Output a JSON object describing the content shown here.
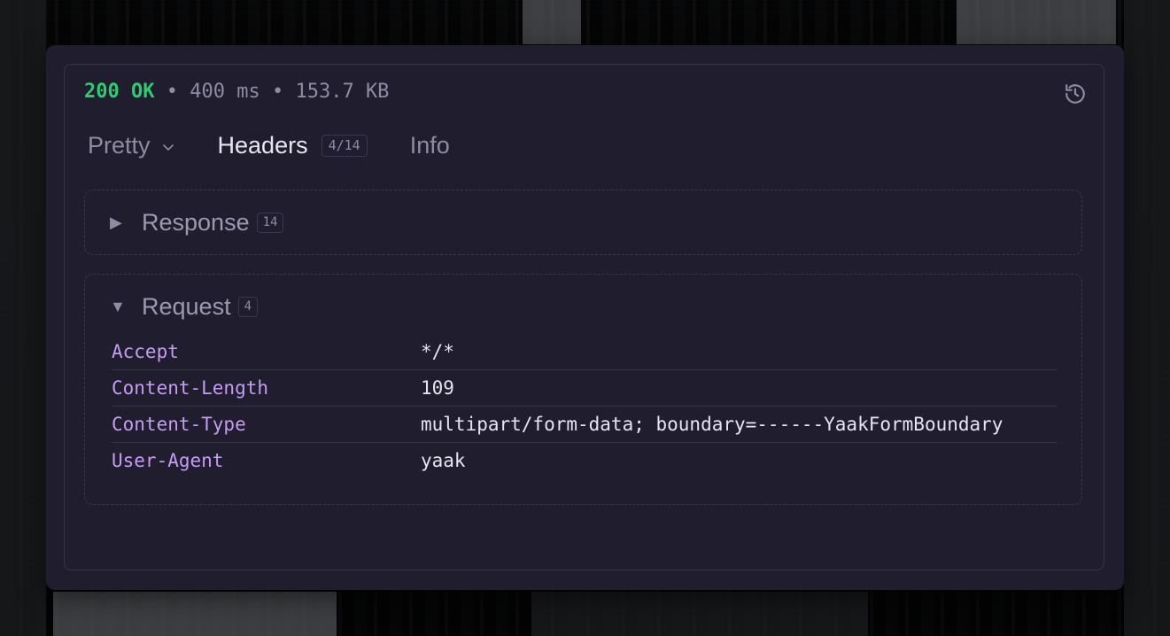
{
  "status": {
    "code": "200 OK",
    "time": "400 ms",
    "size": "153.7 KB",
    "separator": "•"
  },
  "history_icon": "history-icon",
  "tabs": [
    {
      "label": "Pretty",
      "icon": "chevron-down-icon"
    },
    {
      "label": "Headers",
      "badge": "4/14"
    },
    {
      "label": "Info"
    }
  ],
  "response_section": {
    "label": "Response",
    "count": "14",
    "expanded": false
  },
  "request_section": {
    "label": "Request",
    "count": "4",
    "expanded": true,
    "headers": [
      {
        "name": "Accept",
        "value": "*/*"
      },
      {
        "name": "Content-Length",
        "value": "109"
      },
      {
        "name": "Content-Type",
        "value": "multipart/form-data; boundary=------YaakFormBoundary"
      },
      {
        "name": "User-Agent",
        "value": "yaak"
      }
    ]
  },
  "colors": {
    "status_ok": "#2ecc71",
    "header_key": "#c49cf2",
    "window_bg": "#1f1d2e"
  }
}
